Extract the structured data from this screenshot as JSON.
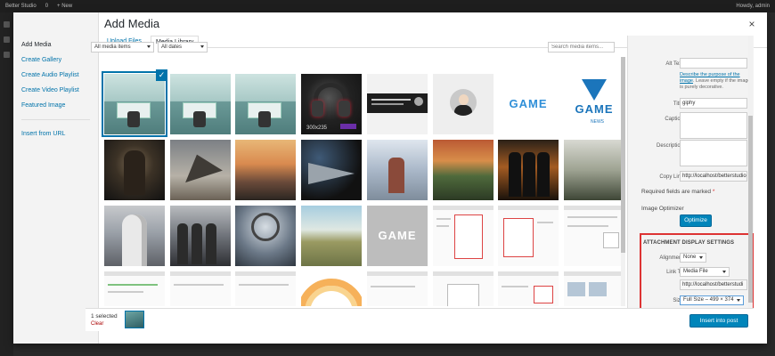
{
  "adminbar": {
    "site": "Better Studio",
    "comments": "0",
    "new": "+ New",
    "greeting": "Howdy, admin"
  },
  "modal": {
    "title": "Add Media",
    "close_glyph": "×",
    "menu": [
      {
        "label": "Add Media",
        "active": true
      },
      {
        "label": "Create Gallery"
      },
      {
        "label": "Create Audio Playlist"
      },
      {
        "label": "Create Video Playlist"
      },
      {
        "label": "Featured Image"
      },
      {
        "label": "Insert from URL"
      }
    ],
    "tabs": {
      "upload": "Upload Files",
      "library": "Media Library"
    },
    "toolbar": {
      "type_filter": "All media items",
      "date_filter": "All dates",
      "search_placeholder": "Search media items..."
    },
    "selected_check": "✓",
    "tile_text": {
      "game": "GAME",
      "news": "NEWS",
      "headset_caption": "300x235"
    }
  },
  "details": {
    "alt_label": "Alt Text",
    "alt_help_link": "Describe the purpose of the image",
    "alt_help_rest": ". Leave empty if the image is purely decorative.",
    "title_label": "Title",
    "title_value": "giphy",
    "caption_label": "Caption",
    "description_label": "Description",
    "copy_label": "Copy Link",
    "copy_value": "http://localhost/betterstudio",
    "required_note": "Required fields are marked",
    "required_star": "*",
    "optimizer_label": "Image Optimizer",
    "optimize_button": "Optimize",
    "settings_title": "ATTACHMENT DISPLAY SETTINGS",
    "alignment_label": "Alignment",
    "alignment_value": "None",
    "linkto_label": "Link To",
    "linkto_value": "Media File",
    "link_url": "http://localhost/betterstudi",
    "size_label": "Size",
    "size_value": "Full Size – 499 × 374"
  },
  "footer": {
    "selected": "1 selected",
    "clear": "Clear",
    "insert": "Insert into post"
  },
  "colors": {
    "accent": "#0073aa",
    "button": "#0085ba",
    "highlight_box": "#dd3333"
  }
}
